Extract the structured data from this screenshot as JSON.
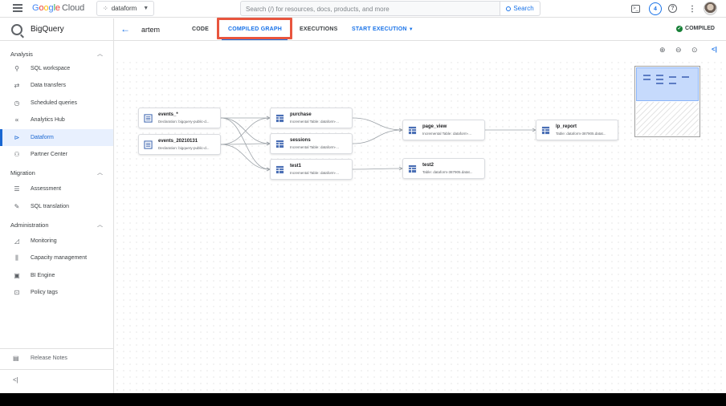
{
  "topbar": {
    "brand_parts": [
      "G",
      "o",
      "o",
      "g",
      "l",
      "e"
    ],
    "brand_suffix": "Cloud",
    "project": "dataform",
    "search_placeholder": "Search (/) for resources, docs, products, and more",
    "search_button": "Search",
    "notification_count": "4"
  },
  "sidebar": {
    "title": "BigQuery",
    "sections": [
      {
        "label": "Analysis",
        "items": [
          "SQL workspace",
          "Data transfers",
          "Scheduled queries",
          "Analytics Hub",
          "Dataform",
          "Partner Center"
        ]
      },
      {
        "label": "Migration",
        "items": [
          "Assessment",
          "SQL translation"
        ]
      },
      {
        "label": "Administration",
        "items": [
          "Monitoring",
          "Capacity management",
          "BI Engine",
          "Policy tags"
        ]
      }
    ],
    "active_item": "Dataform",
    "release_notes": "Release Notes"
  },
  "main": {
    "repo_name": "artem",
    "tabs": {
      "code": "CODE",
      "compiled_graph": "COMPILED GRAPH",
      "executions": "EXECUTIONS",
      "start_execution": "START EXECUTION"
    },
    "active_tab": "COMPILED GRAPH",
    "status": "COMPILED"
  },
  "graph": {
    "nodes": [
      {
        "id": "events_star",
        "name": "events_*",
        "subtitle": "Declaration: bigquery-public-d..."
      },
      {
        "id": "events_20210131",
        "name": "events_20210131",
        "subtitle": "Declaration: bigquery-public-d..."
      },
      {
        "id": "purchase",
        "name": "purchase",
        "subtitle": "Incremental Table: dataform-..."
      },
      {
        "id": "sessions",
        "name": "sessions",
        "subtitle": "Incremental Table: dataform-..."
      },
      {
        "id": "test1",
        "name": "test1",
        "subtitle": "Incremental Table: dataform-..."
      },
      {
        "id": "page_view",
        "name": "page_view",
        "subtitle": "Incremental Table: dataform-..."
      },
      {
        "id": "test2",
        "name": "test2",
        "subtitle": "Table: dataform-387905.datat..."
      },
      {
        "id": "lp_report",
        "name": "lp_report",
        "subtitle": "Table: dataform-387905.datat..."
      }
    ],
    "edges": [
      [
        "events_star",
        "purchase"
      ],
      [
        "events_star",
        "sessions"
      ],
      [
        "events_star",
        "test1"
      ],
      [
        "events_20210131",
        "purchase"
      ],
      [
        "events_20210131",
        "sessions"
      ],
      [
        "events_20210131",
        "test1"
      ],
      [
        "purchase",
        "page_view"
      ],
      [
        "sessions",
        "page_view"
      ],
      [
        "test1",
        "test2"
      ],
      [
        "page_view",
        "lp_report"
      ]
    ]
  },
  "colors": {
    "accent": "#1a73e8",
    "highlight_box": "#e8553e",
    "compiled_ok": "#188038"
  }
}
